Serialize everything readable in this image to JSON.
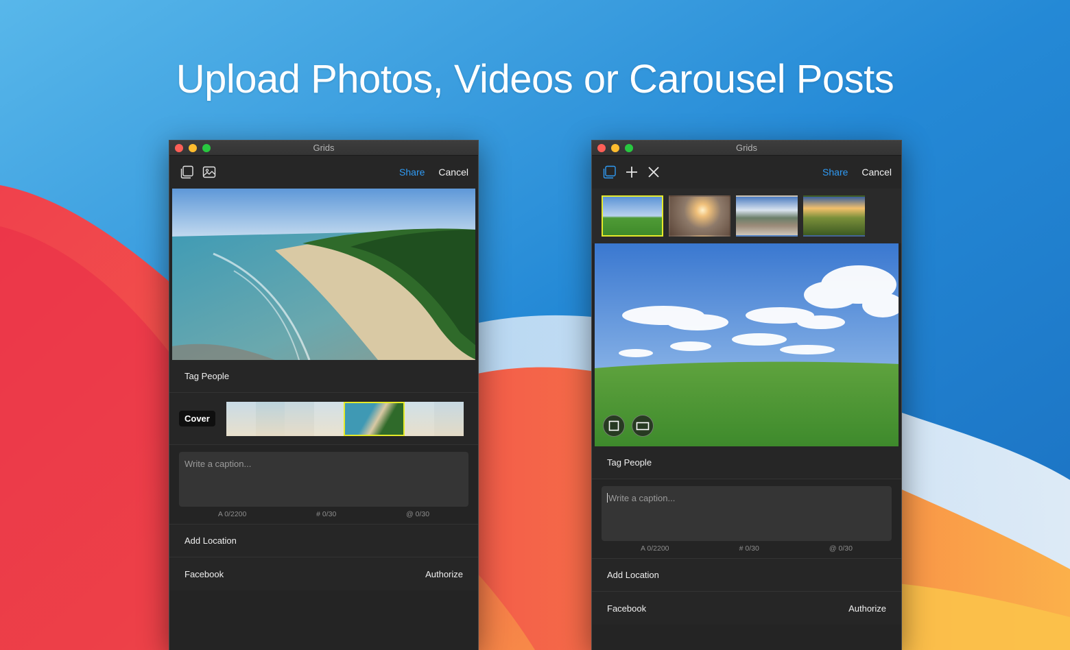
{
  "headline": "Upload Photos, Videos or Carousel Posts",
  "colors": {
    "accent_blue": "#2f9bf5",
    "selection_yellow": "#e6ea2a",
    "window_bg": "#242424"
  },
  "left_window": {
    "title": "Grids",
    "toolbar": {
      "icons": [
        "carousel-icon",
        "image-icon"
      ],
      "share_label": "Share",
      "cancel_label": "Cancel"
    },
    "tag_people_label": "Tag People",
    "cover_label": "Cover",
    "caption_placeholder": "Write a caption...",
    "counters": {
      "chars": "A 0/2200",
      "hashtags": "# 0/30",
      "mentions": "@ 0/30"
    },
    "add_location_label": "Add Location",
    "facebook_label": "Facebook",
    "authorize_label": "Authorize"
  },
  "right_window": {
    "title": "Grids",
    "toolbar": {
      "icons": [
        "carousel-icon",
        "plus-icon",
        "close-icon"
      ],
      "share_label": "Share",
      "cancel_label": "Cancel"
    },
    "thumbnails": [
      "green-field",
      "sunset-reeds",
      "mountain-cliff",
      "valley-sunset"
    ],
    "crop_buttons": [
      "square-crop-icon",
      "landscape-crop-icon"
    ],
    "tag_people_label": "Tag People",
    "caption_placeholder": "Write a caption...",
    "counters": {
      "chars": "A 0/2200",
      "hashtags": "# 0/30",
      "mentions": "@ 0/30"
    },
    "add_location_label": "Add Location",
    "facebook_label": "Facebook",
    "authorize_label": "Authorize"
  }
}
